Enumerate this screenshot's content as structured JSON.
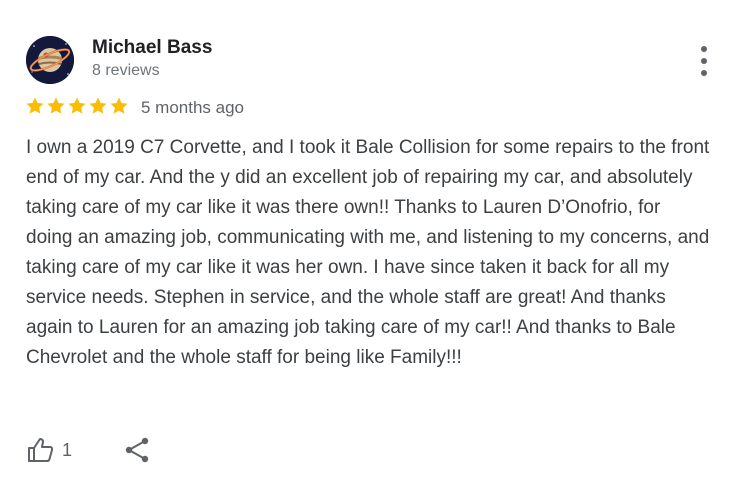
{
  "review": {
    "author_name": "Michael Bass",
    "author_reviews": "8 reviews",
    "rating": 5,
    "rating_max": 5,
    "date": "5 months ago",
    "text": "I own a 2019 C7 Corvette, and I took it Bale Collision for some repairs to the front end of my car. And the y did an excellent job of repairing my car, and absolutely taking care of my car like it was there own!! Thanks to Lauren D’Onofrio, for doing an amazing job, communicating with me, and listening to my concerns, and taking care of my car like it was her own. I have since taken it back for all my service needs. Stephen in service, and the whole staff are great! And thanks again to Lauren for an amazing job taking care of my car!! And thanks to Bale Chevrolet and the whole staff for being like Family!!!",
    "like_count": "1"
  },
  "icons": {
    "avatar": "planet-icon",
    "more": "more-vert-icon",
    "star": "star-icon",
    "like": "thumbs-up-icon",
    "share": "share-icon"
  },
  "colors": {
    "star": "#fbbc04",
    "name": "#202124",
    "secondary": "#70757a",
    "body_text": "#3c4043",
    "icon": "#5f6368"
  }
}
